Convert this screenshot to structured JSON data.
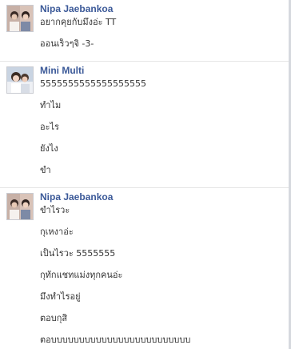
{
  "chat": {
    "groups": [
      {
        "sender": "Nipa Jaebankoa",
        "avatar_icon": "profile-photo-avatar",
        "messages": [
          "อยากคุยกับมึงอ่ะ TT",
          "ออนเร็วๆจิ -3-"
        ]
      },
      {
        "sender": "Mini Multi",
        "avatar_icon": "profile-photo-avatar",
        "messages": [
          "5555555555555555555",
          "ทำไม",
          "อะไร",
          "ยังไง",
          "ขำ"
        ]
      },
      {
        "sender": "Nipa Jaebankoa",
        "avatar_icon": "profile-photo-avatar",
        "messages": [
          "ขำไรวะ",
          "กุเหงาอ่ะ",
          "เป็นไรวะ 5555555",
          "กุทักแชทแม่งทุกคนอ่ะ",
          "มึงทำไรอยู่",
          "ตอบกุสิ",
          "ตอบบบบบบบบบบบบบบบบบบบบบบบบบ"
        ]
      }
    ],
    "colors": {
      "sender_name": "#3b5998",
      "message_text": "#333333",
      "divider": "#e5e5e5",
      "background": "#ffffff"
    }
  }
}
